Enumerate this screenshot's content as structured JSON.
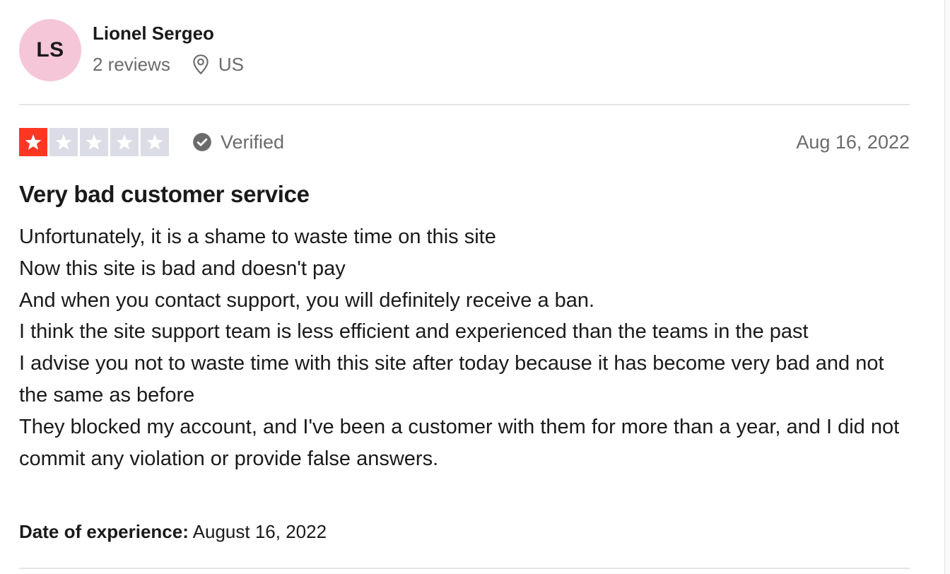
{
  "consumer": {
    "initials": "LS",
    "name": "Lionel Sergeo",
    "review_count": "2 reviews",
    "location": "US"
  },
  "review": {
    "rating": 1,
    "max_rating": 5,
    "verified_label": "Verified",
    "date": "Aug 16, 2022",
    "title": "Very bad customer service",
    "body_lines": [
      "Unfortunately, it is a shame to waste time on this site",
      "Now this site is bad and doesn't pay",
      "And when you contact support, you will definitely receive a ban.",
      "I think the site support team is less efficient and experienced than the teams in the past",
      "I advise you not to waste time with this site after today because it has become very bad and not the same as before",
      "They blocked my account, and I've been a customer with them for more than a year, and I did not commit any violation or provide false answers."
    ],
    "experience_label": "Date of experience:",
    "experience_date": "August 16, 2022"
  },
  "icons": {
    "location": "map-pin-icon",
    "verified": "check-circle-icon",
    "star": "star-icon"
  },
  "colors": {
    "star_filled": "#ff3722",
    "star_empty": "#dcdce6",
    "avatar_bg": "#f5c6d8",
    "muted_text": "#6b6b6b"
  }
}
